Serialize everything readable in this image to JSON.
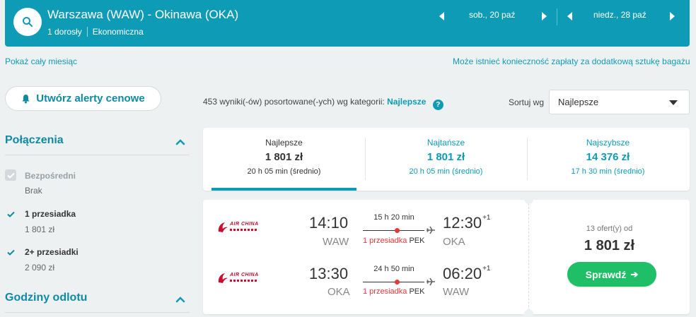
{
  "header": {
    "route": "Warszawa (WAW) - Okinawa (OKA)",
    "passengers": "1 dorosły",
    "cabin": "Ekonomiczna",
    "departure_date": "sob., 20 paź",
    "return_date": "niedz., 28 paź"
  },
  "links": {
    "show_month": "Pokaż cały miesiąc",
    "baggage_notice": "Może istnieć konieczność zapłaty za dodatkową sztukę bagażu"
  },
  "sidebar": {
    "alert_button": "Utwórz alerty cenowe",
    "connections_title": "Połączenia",
    "options": [
      {
        "label": "Bezpośredni",
        "sub": "Brak",
        "checked": true,
        "disabled": true
      },
      {
        "label": "1 przesiadka",
        "sub": "1 801 zł",
        "checked": true,
        "disabled": false
      },
      {
        "label": "2+ przesiadki",
        "sub": "2 090 zł",
        "checked": true,
        "disabled": false
      }
    ],
    "departure_times_title": "Godziny odlotu"
  },
  "results": {
    "count_text": "453 wyniki(-ów) posortowane(-ych) wg kategorii:",
    "category": "Najlepsze",
    "help": "?",
    "sort_label": "Sortuj wg",
    "sort_value": "Najlepsze"
  },
  "tabs": [
    {
      "name": "Najlepsze",
      "price": "1 801 zł",
      "time": "20 h 05 min (średnio)",
      "active": true
    },
    {
      "name": "Najtańsze",
      "price": "1 801 zł",
      "time": "20 h 05 min (średnio)",
      "active": false
    },
    {
      "name": "Najszybsze",
      "price": "14 376 zł",
      "time": "17 h 30 min (średnio)",
      "active": false
    }
  ],
  "result_card": {
    "airline": "AIR CHINA",
    "legs": [
      {
        "dep_time": "14:10",
        "dep_code": "WAW",
        "arr_time": "12:30",
        "arr_offset": "+1",
        "arr_code": "OKA",
        "duration": "15 h 20 min",
        "stops": "1 przesiadka",
        "via": "PEK"
      },
      {
        "dep_time": "13:30",
        "dep_code": "OKA",
        "arr_time": "06:20",
        "arr_offset": "+1",
        "arr_code": "WAW",
        "duration": "24 h 50 min",
        "stops": "1 przesiadka",
        "via": "PEK"
      }
    ],
    "offers": "13 ofert(y) od",
    "price": "1 801 zł",
    "button": "Sprawdź",
    "button_arrow": "➔"
  },
  "colors": {
    "brand": "#0e9bb5",
    "cta": "#1fbf67",
    "stop": "#e5383b",
    "airline": "#c8102e"
  }
}
